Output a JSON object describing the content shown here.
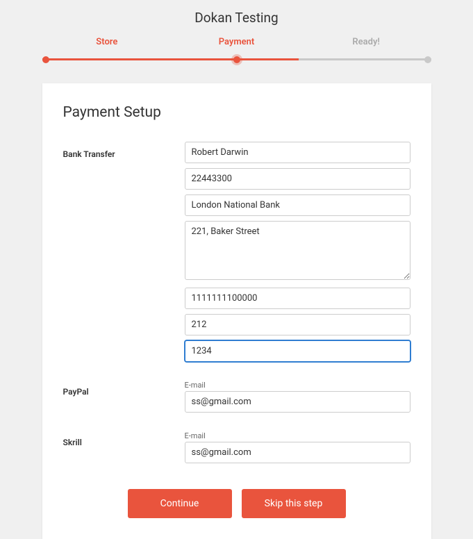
{
  "header": {
    "title": "Dokan Testing"
  },
  "stepper": {
    "steps": [
      {
        "label": "Store",
        "state": "done"
      },
      {
        "label": "Payment",
        "state": "active"
      },
      {
        "label": "Ready!",
        "state": "pending"
      }
    ]
  },
  "page": {
    "title": "Payment Setup"
  },
  "sections": {
    "bank_transfer": {
      "label": "Bank Transfer",
      "account_name": "Robert Darwin",
      "account_number": "22443300",
      "bank_name": "London National Bank",
      "bank_address": "221, Baker Street",
      "routing_number": "1111111100000",
      "iban": "212",
      "swift": "1234"
    },
    "paypal": {
      "label": "PayPal",
      "email_label": "E-mail",
      "email_value": "ss@gmail.com"
    },
    "skrill": {
      "label": "Skrill",
      "email_label": "E-mail",
      "email_value": "ss@gmail.com"
    }
  },
  "buttons": {
    "continue": "Continue",
    "skip": "Skip this step"
  }
}
